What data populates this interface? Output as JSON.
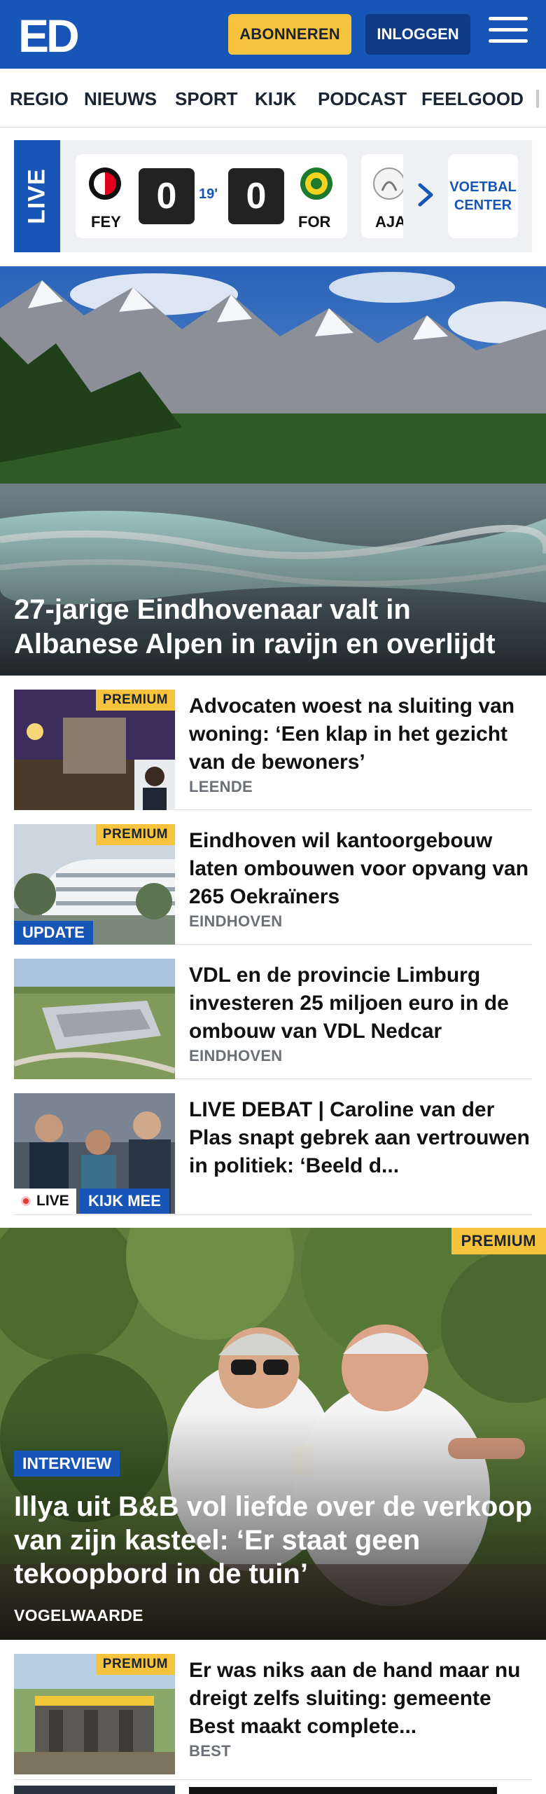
{
  "header": {
    "logo_text": "ED",
    "subscribe_label": "ABONNEREN",
    "login_label": "INLOGGEN",
    "brand_color": "#1755b6",
    "accent_color": "#f6c33c"
  },
  "nav": {
    "items": [
      "REGIO",
      "NIEUWS",
      "SPORT",
      "KIJK",
      "PODCAST",
      "FEELGOOD"
    ]
  },
  "live_scores": {
    "tab_label": "LIVE",
    "match": {
      "home": "FEY",
      "away": "FOR",
      "home_score": "0",
      "away_score": "0",
      "minute": "19'"
    },
    "next_match_home": "AJA",
    "voetbal_center_label": "VOETBAL CENTER"
  },
  "hero": {
    "title": "27-jarige Eindhovenaar valt in Albanese Alpen in ravijn en overlijdt"
  },
  "articles": [
    {
      "premium": "PREMIUM",
      "title": "Advocaten woest na sluiting van woning: ‘Een klap in het gezicht van de bewoners’",
      "location": "LEENDE"
    },
    {
      "premium": "PREMIUM",
      "tag": "UPDATE",
      "title": "Eindhoven wil kantoorgebouw laten ombouwen voor opvang van 265 Oekraïners",
      "location": "EINDHOVEN"
    },
    {
      "title": "VDL en de provincie Limburg investeren 25 miljoen euro in de ombouw van VDL Nedcar",
      "location": "EINDHOVEN"
    },
    {
      "live_label": "LIVE",
      "watch_label": "KIJK MEE",
      "title": "LIVE DEBAT | Caroline van der Plas snapt gebrek aan vertrouwen in politiek: ‘Beeld d..."
    }
  ],
  "feature": {
    "premium": "PREMIUM",
    "tag": "INTERVIEW",
    "title": "Illya uit B&B vol liefde over de verkoop van zijn kasteel: ‘Er staat geen tekoopbord in de tuin’",
    "location": "VOGELWAARDE"
  },
  "bottom_article": {
    "premium": "PREMIUM",
    "title": "Er was niks aan de hand maar nu dreigt zelfs sluiting: gemeente Best maakt complete...",
    "location": "BEST"
  }
}
